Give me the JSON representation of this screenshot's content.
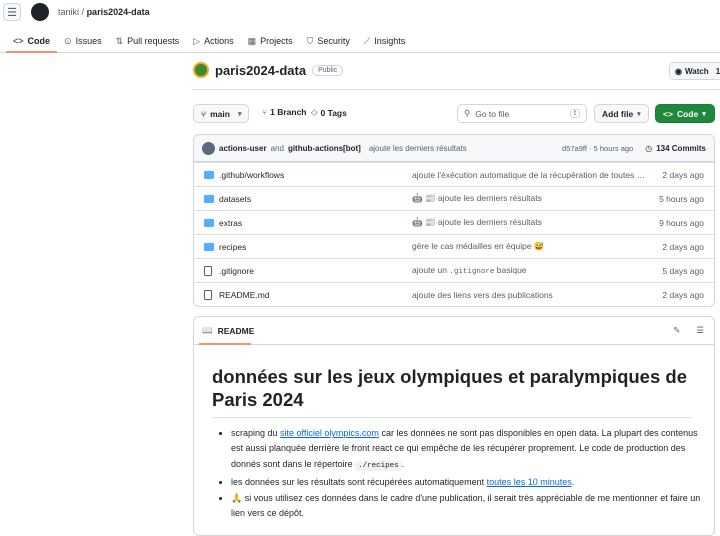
{
  "header": {
    "owner": "taniki",
    "separator": "/",
    "repo": "paris2024-data"
  },
  "tabs": [
    {
      "label": "Code",
      "icon": "<>"
    },
    {
      "label": "Issues",
      "icon": "⊙"
    },
    {
      "label": "Pull requests",
      "icon": "⇅"
    },
    {
      "label": "Actions",
      "icon": "▷"
    },
    {
      "label": "Projects",
      "icon": "▦"
    },
    {
      "label": "Security",
      "icon": "⛉"
    },
    {
      "label": "Insights",
      "icon": "⟋"
    }
  ],
  "repo": {
    "name": "paris2024-data",
    "visibility": "Public",
    "watch_label": "Watch",
    "watch_count": "1"
  },
  "toolbar": {
    "branch": "main",
    "branches": "1 Branch",
    "tags": "0 Tags",
    "search_placeholder": "Go to file",
    "search_key": "t",
    "add_file": "Add file",
    "code": "Code"
  },
  "commit": {
    "author1": "actions-user",
    "and": "and",
    "author2": "github-actions[bot]",
    "message": "ajoute les derniers résultats",
    "sha_time": "d57a9ff · 5 hours ago",
    "commits": "134 Commits"
  },
  "files": [
    {
      "name": ".github/workflows",
      "type": "dir",
      "message": "ajoute l'éxécution automatique de la récupération de toutes les données",
      "date": "2 days ago"
    },
    {
      "name": "datasets",
      "type": "dir",
      "message": "🤖 📰 ajoute les derniers résultats",
      "date": "5 hours ago"
    },
    {
      "name": "extras",
      "type": "dir",
      "message": "🤖 📰 ajoute les derniers résultats",
      "date": "9 hours ago"
    },
    {
      "name": "recipes",
      "type": "dir",
      "message": "gère le cas médailles en équipe 😅",
      "date": "2 days ago"
    },
    {
      "name": ".gitignore",
      "type": "file",
      "message_pre": "ajoute un",
      "message_code": ".gitignore",
      "message_post": "basique",
      "date": "5 days ago"
    },
    {
      "name": "README.md",
      "type": "file",
      "message": "ajoute des liens vers des publications",
      "date": "2 days ago"
    }
  ],
  "readme": {
    "tab": "README",
    "title": "données sur les jeux olympiques et paralympiques de Paris 2024",
    "b1_pre": "scraping du",
    "b1_link": "site officiel olympics.com",
    "b1_post": "car les données ne sont pas disponibles en open data. La plupart des contenus est aussi planquée derrière le front react ce qui empêche de les récupérer proprement. Le code de production des donnés sont dans le répertoire",
    "b1_code": "./recipes",
    "b1_end": ".",
    "b2_pre": "les données sur les résultats sont récupérées automatiquement",
    "b2_link": "toutes les 10 minutes",
    "b2_end": ".",
    "b3_emoji": "🙏",
    "b3_text": "si vous utilisez ces données dans le cadre d'une publication, il serait très appréciable de me mentionner et faire un lien vers ce dépôt."
  }
}
